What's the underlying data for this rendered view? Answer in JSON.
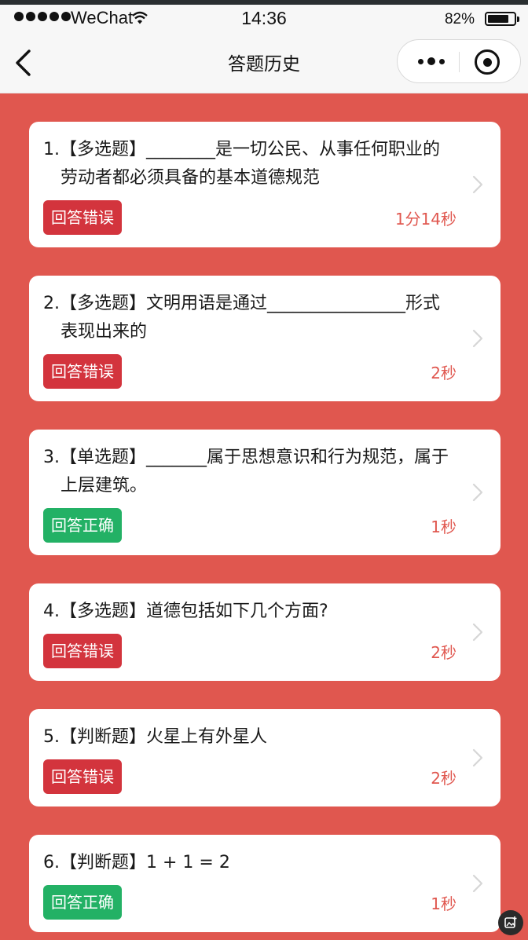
{
  "status_bar": {
    "carrier": "WeChat",
    "time": "14:36",
    "battery_percent": "82%",
    "battery_level": 0.82,
    "signal_icon": "signal-dots-icon",
    "wifi_icon": "wifi-icon",
    "battery_icon": "battery-icon"
  },
  "nav": {
    "title": "答题历史",
    "back_icon": "chevron-left-icon",
    "more_icon": "more-dots-icon",
    "close_icon": "close-miniprogram-icon"
  },
  "colors": {
    "background": "#e0574f",
    "wrong": "#d3343d",
    "right": "#23b165",
    "time": "#e0574f"
  },
  "questions": [
    {
      "text": "1.【多选题】________是一切公民、从事任何职业的劳动者都必须具备的基本道德规范",
      "result": "回答错误",
      "correct": false,
      "duration": "1分14秒"
    },
    {
      "text": "2.【多选题】文明用语是通过________________形式表现出来的",
      "result": "回答错误",
      "correct": false,
      "duration": "2秒"
    },
    {
      "text": "3.【单选题】_______属于思想意识和行为规范，属于上层建筑。",
      "result": "回答正确",
      "correct": true,
      "duration": "1秒"
    },
    {
      "text": "4.【多选题】道德包括如下几个方面?",
      "result": "回答错误",
      "correct": false,
      "duration": "2秒"
    },
    {
      "text": "5.【判断题】火星上有外星人",
      "result": "回答错误",
      "correct": false,
      "duration": "2秒"
    },
    {
      "text": "6.【判断题】1 + 1 = 2",
      "result": "回答正确",
      "correct": true,
      "duration": "1秒"
    }
  ],
  "floating_button_icon": "image-edit-icon"
}
